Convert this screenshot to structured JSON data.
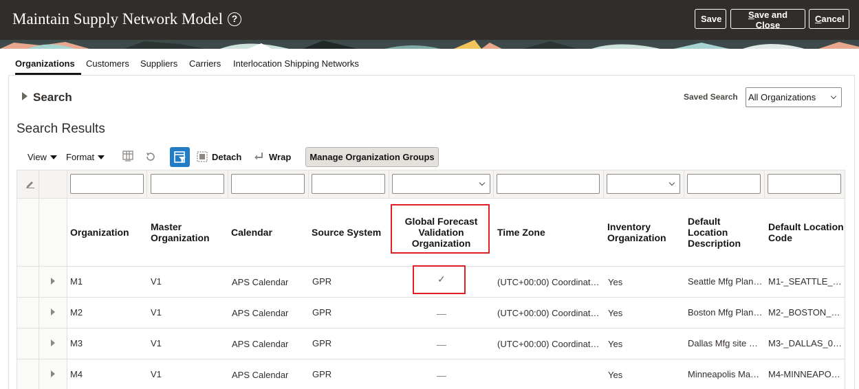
{
  "header": {
    "title": "Maintain Supply Network Model",
    "help_icon": "question-circle-icon",
    "buttons": {
      "save": "Save",
      "save_and_close": "Save and Close",
      "cancel": "Cancel"
    }
  },
  "tabs": [
    "Organizations",
    "Customers",
    "Suppliers",
    "Carriers",
    "Interlocation Shipping Networks"
  ],
  "active_tab": "Organizations",
  "search": {
    "toggle_label": "Search",
    "saved_search_label": "Saved Search",
    "saved_search_value": "All Organizations"
  },
  "results": {
    "title": "Search Results",
    "toolbar": {
      "view": "View",
      "format": "Format",
      "detach": "Detach",
      "wrap": "Wrap",
      "manage_groups": "Manage Organization Groups"
    },
    "columns": [
      "Organization",
      "Master Organization",
      "Calendar",
      "Source System",
      "Global Forecast Validation Organization",
      "Time Zone",
      "Inventory Organization",
      "Default Location Description",
      "Default Location Code"
    ],
    "rows": [
      {
        "organization": "M1",
        "master": "V1",
        "calendar": "APS Calendar",
        "source": "GPR",
        "global_forecast": true,
        "timezone": "(UTC+00:00) Coordinat…",
        "inventory": "Yes",
        "loc_desc": "Seattle Mfg Plan…",
        "loc_code": "M1-_SEATTLE_…"
      },
      {
        "organization": "M2",
        "master": "V1",
        "calendar": "APS Calendar",
        "source": "GPR",
        "global_forecast": false,
        "timezone": "(UTC+00:00) Coordinat…",
        "inventory": "Yes",
        "loc_desc": "Boston Mfg Plan…",
        "loc_code": "M2-_BOSTON_…"
      },
      {
        "organization": "M3",
        "master": "V1",
        "calendar": "APS Calendar",
        "source": "GPR",
        "global_forecast": false,
        "timezone": "(UTC+00:00) Coordinat…",
        "inventory": "Yes",
        "loc_desc": "Dallas Mfg site …",
        "loc_code": "M3-_DALLAS_0…"
      },
      {
        "organization": "M4",
        "master": "V1",
        "calendar": "APS Calendar",
        "source": "GPR",
        "global_forecast": false,
        "timezone": "",
        "inventory": "Yes",
        "loc_desc": "Minneapolis Ma…",
        "loc_code": "M4-MINNEAPO…"
      }
    ]
  },
  "colors": {
    "header_bg": "#312d2a",
    "accent": "#227bc5",
    "highlight": "#e21f26"
  }
}
